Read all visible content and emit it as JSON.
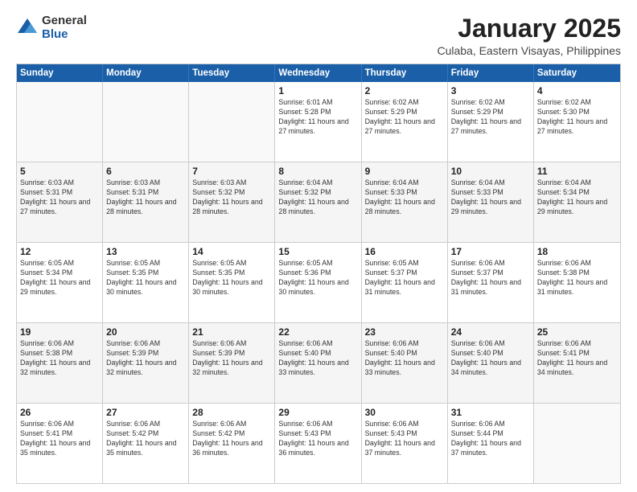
{
  "logo": {
    "general": "General",
    "blue": "Blue"
  },
  "title": "January 2025",
  "subtitle": "Culaba, Eastern Visayas, Philippines",
  "days_of_week": [
    "Sunday",
    "Monday",
    "Tuesday",
    "Wednesday",
    "Thursday",
    "Friday",
    "Saturday"
  ],
  "weeks": [
    [
      {
        "day": "",
        "info": ""
      },
      {
        "day": "",
        "info": ""
      },
      {
        "day": "",
        "info": ""
      },
      {
        "day": "1",
        "info": "Sunrise: 6:01 AM\nSunset: 5:28 PM\nDaylight: 11 hours and 27 minutes."
      },
      {
        "day": "2",
        "info": "Sunrise: 6:02 AM\nSunset: 5:29 PM\nDaylight: 11 hours and 27 minutes."
      },
      {
        "day": "3",
        "info": "Sunrise: 6:02 AM\nSunset: 5:29 PM\nDaylight: 11 hours and 27 minutes."
      },
      {
        "day": "4",
        "info": "Sunrise: 6:02 AM\nSunset: 5:30 PM\nDaylight: 11 hours and 27 minutes."
      }
    ],
    [
      {
        "day": "5",
        "info": "Sunrise: 6:03 AM\nSunset: 5:31 PM\nDaylight: 11 hours and 27 minutes."
      },
      {
        "day": "6",
        "info": "Sunrise: 6:03 AM\nSunset: 5:31 PM\nDaylight: 11 hours and 28 minutes."
      },
      {
        "day": "7",
        "info": "Sunrise: 6:03 AM\nSunset: 5:32 PM\nDaylight: 11 hours and 28 minutes."
      },
      {
        "day": "8",
        "info": "Sunrise: 6:04 AM\nSunset: 5:32 PM\nDaylight: 11 hours and 28 minutes."
      },
      {
        "day": "9",
        "info": "Sunrise: 6:04 AM\nSunset: 5:33 PM\nDaylight: 11 hours and 28 minutes."
      },
      {
        "day": "10",
        "info": "Sunrise: 6:04 AM\nSunset: 5:33 PM\nDaylight: 11 hours and 29 minutes."
      },
      {
        "day": "11",
        "info": "Sunrise: 6:04 AM\nSunset: 5:34 PM\nDaylight: 11 hours and 29 minutes."
      }
    ],
    [
      {
        "day": "12",
        "info": "Sunrise: 6:05 AM\nSunset: 5:34 PM\nDaylight: 11 hours and 29 minutes."
      },
      {
        "day": "13",
        "info": "Sunrise: 6:05 AM\nSunset: 5:35 PM\nDaylight: 11 hours and 30 minutes."
      },
      {
        "day": "14",
        "info": "Sunrise: 6:05 AM\nSunset: 5:35 PM\nDaylight: 11 hours and 30 minutes."
      },
      {
        "day": "15",
        "info": "Sunrise: 6:05 AM\nSunset: 5:36 PM\nDaylight: 11 hours and 30 minutes."
      },
      {
        "day": "16",
        "info": "Sunrise: 6:05 AM\nSunset: 5:37 PM\nDaylight: 11 hours and 31 minutes."
      },
      {
        "day": "17",
        "info": "Sunrise: 6:06 AM\nSunset: 5:37 PM\nDaylight: 11 hours and 31 minutes."
      },
      {
        "day": "18",
        "info": "Sunrise: 6:06 AM\nSunset: 5:38 PM\nDaylight: 11 hours and 31 minutes."
      }
    ],
    [
      {
        "day": "19",
        "info": "Sunrise: 6:06 AM\nSunset: 5:38 PM\nDaylight: 11 hours and 32 minutes."
      },
      {
        "day": "20",
        "info": "Sunrise: 6:06 AM\nSunset: 5:39 PM\nDaylight: 11 hours and 32 minutes."
      },
      {
        "day": "21",
        "info": "Sunrise: 6:06 AM\nSunset: 5:39 PM\nDaylight: 11 hours and 32 minutes."
      },
      {
        "day": "22",
        "info": "Sunrise: 6:06 AM\nSunset: 5:40 PM\nDaylight: 11 hours and 33 minutes."
      },
      {
        "day": "23",
        "info": "Sunrise: 6:06 AM\nSunset: 5:40 PM\nDaylight: 11 hours and 33 minutes."
      },
      {
        "day": "24",
        "info": "Sunrise: 6:06 AM\nSunset: 5:40 PM\nDaylight: 11 hours and 34 minutes."
      },
      {
        "day": "25",
        "info": "Sunrise: 6:06 AM\nSunset: 5:41 PM\nDaylight: 11 hours and 34 minutes."
      }
    ],
    [
      {
        "day": "26",
        "info": "Sunrise: 6:06 AM\nSunset: 5:41 PM\nDaylight: 11 hours and 35 minutes."
      },
      {
        "day": "27",
        "info": "Sunrise: 6:06 AM\nSunset: 5:42 PM\nDaylight: 11 hours and 35 minutes."
      },
      {
        "day": "28",
        "info": "Sunrise: 6:06 AM\nSunset: 5:42 PM\nDaylight: 11 hours and 36 minutes."
      },
      {
        "day": "29",
        "info": "Sunrise: 6:06 AM\nSunset: 5:43 PM\nDaylight: 11 hours and 36 minutes."
      },
      {
        "day": "30",
        "info": "Sunrise: 6:06 AM\nSunset: 5:43 PM\nDaylight: 11 hours and 37 minutes."
      },
      {
        "day": "31",
        "info": "Sunrise: 6:06 AM\nSunset: 5:44 PM\nDaylight: 11 hours and 37 minutes."
      },
      {
        "day": "",
        "info": ""
      }
    ]
  ]
}
